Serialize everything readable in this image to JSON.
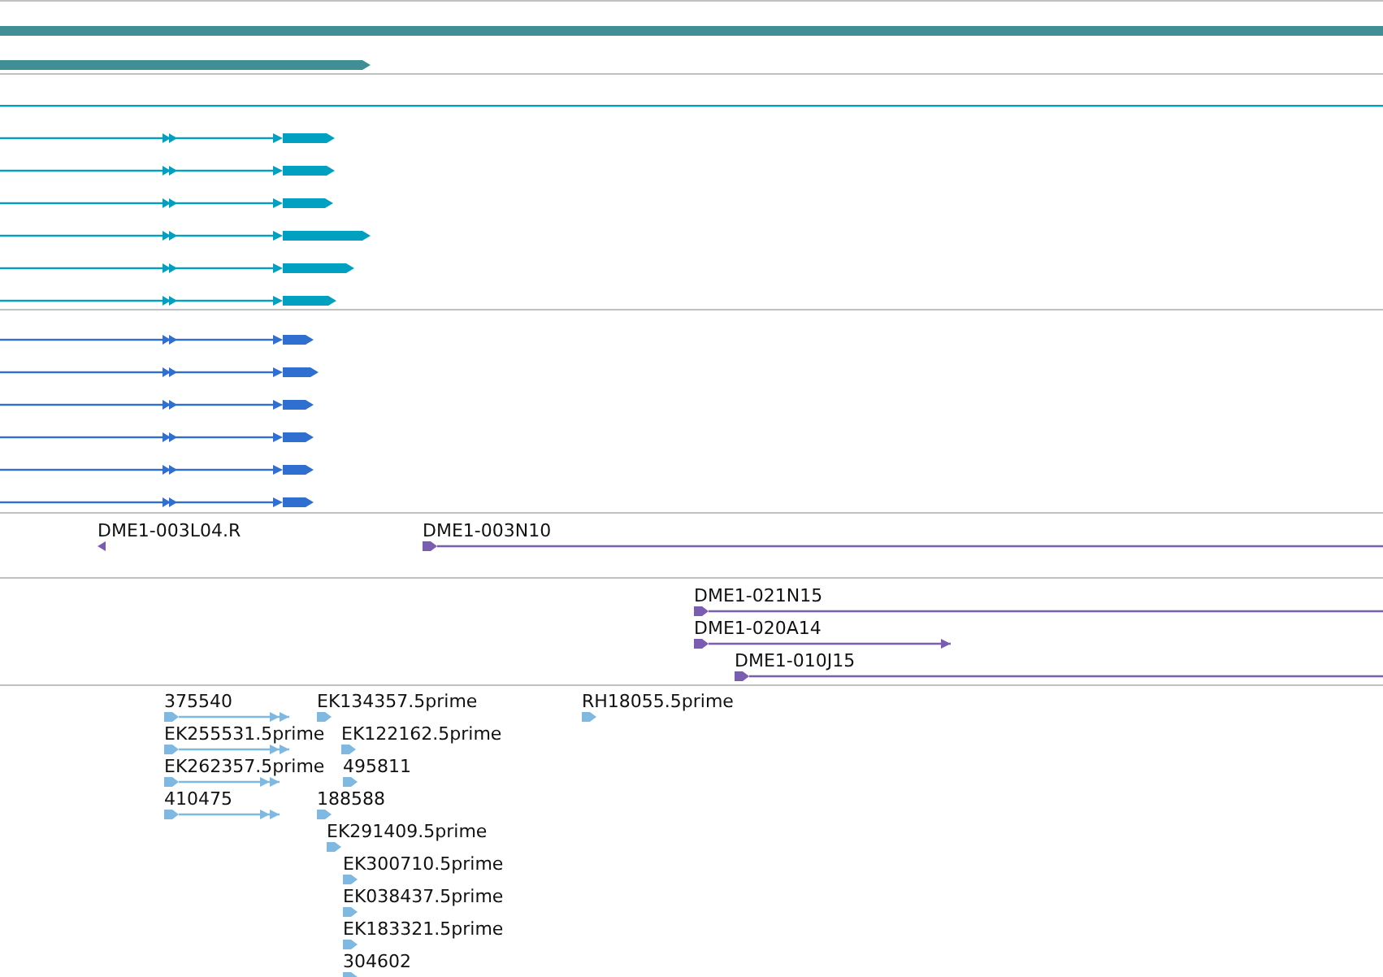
{
  "tracks": [
    {
      "kind": "gene-span",
      "color": "#3f8f94"
    },
    {
      "kind": "transcripts",
      "color": "#00a0c0"
    },
    {
      "kind": "transcripts",
      "color": "#2f6fcf"
    },
    {
      "kind": "clones",
      "color": "#7a5cb0",
      "features": [
        {
          "label": "DME1-003L04.R"
        },
        {
          "label": "DME1-003N10"
        }
      ]
    },
    {
      "kind": "clones",
      "color": "#7a5cb0",
      "features": [
        {
          "label": "DME1-021N15"
        },
        {
          "label": "DME1-020A14"
        },
        {
          "label": "DME1-010J15"
        }
      ]
    },
    {
      "kind": "ests",
      "color": "#7fb8e0",
      "features": [
        {
          "label": "375540"
        },
        {
          "label": "EK134357.5prime"
        },
        {
          "label": "RH18055.5prime"
        },
        {
          "label": "EK255531.5prime"
        },
        {
          "label": "EK122162.5prime"
        },
        {
          "label": "EK262357.5prime"
        },
        {
          "label": "495811"
        },
        {
          "label": "410475"
        },
        {
          "label": "188588"
        },
        {
          "label": "EK291409.5prime"
        },
        {
          "label": "EK300710.5prime"
        },
        {
          "label": "EK038437.5prime"
        },
        {
          "label": "EK183321.5prime"
        },
        {
          "label": "304602"
        }
      ]
    }
  ]
}
